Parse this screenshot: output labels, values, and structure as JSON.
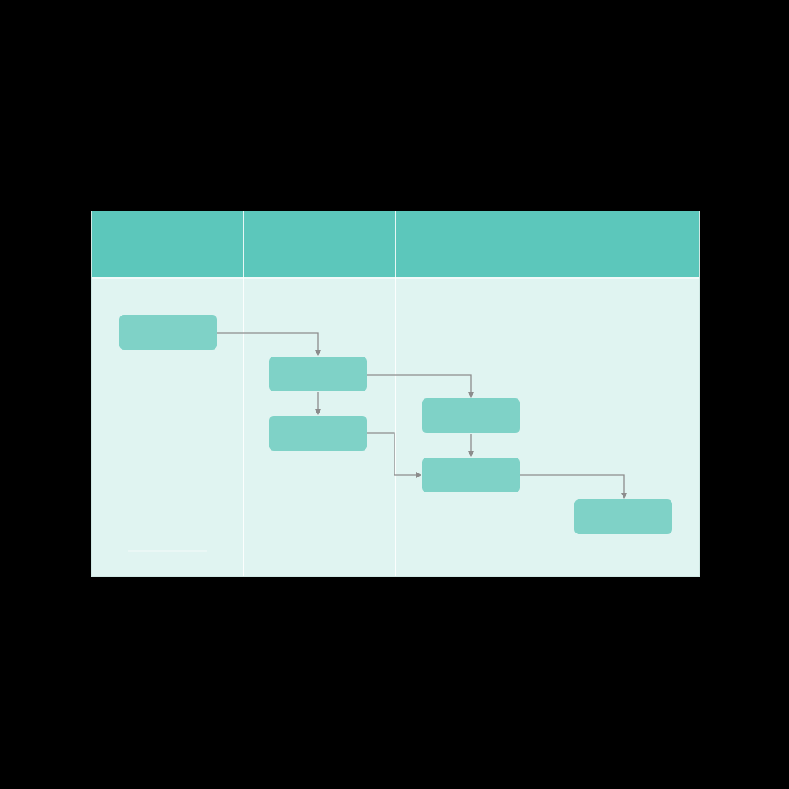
{
  "diagram": {
    "colors": {
      "header": "#5cc7bb",
      "body": "#e0f4f1",
      "task": "#7fd2c7",
      "connector": "#8c8c8c",
      "divider": "#ffffff"
    },
    "lanes": [
      {
        "label": ""
      },
      {
        "label": ""
      },
      {
        "label": ""
      },
      {
        "label": ""
      }
    ],
    "tasks": [
      {
        "label": "",
        "lane": 1
      },
      {
        "label": "",
        "lane": 2
      },
      {
        "label": "",
        "lane": 2
      },
      {
        "label": "",
        "lane": 3
      },
      {
        "label": "",
        "lane": 3
      },
      {
        "label": "",
        "lane": 4
      }
    ],
    "connections": [
      {
        "from": 1,
        "to": 2
      },
      {
        "from": 2,
        "to": 3
      },
      {
        "from": 2,
        "to": 4
      },
      {
        "from": 3,
        "to": 5
      },
      {
        "from": 4,
        "to": 5
      },
      {
        "from": 5,
        "to": 6
      }
    ]
  }
}
